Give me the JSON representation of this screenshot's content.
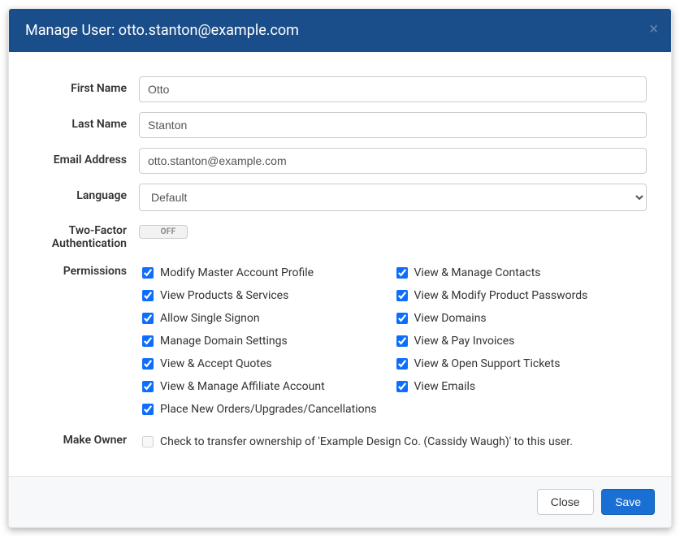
{
  "header": {
    "title": "Manage User: otto.stanton@example.com"
  },
  "labels": {
    "firstName": "First Name",
    "lastName": "Last Name",
    "email": "Email Address",
    "language": "Language",
    "twoFactor": "Two-Factor Authentication",
    "permissions": "Permissions",
    "makeOwner": "Make Owner"
  },
  "values": {
    "firstName": "Otto",
    "lastName": "Stanton",
    "email": "otto.stanton@example.com",
    "language": "Default",
    "twoFactorState": "OFF"
  },
  "permissions": {
    "col1": [
      "Modify Master Account Profile",
      "View Products & Services",
      "Allow Single Signon",
      "Manage Domain Settings",
      "View & Accept Quotes",
      "View & Manage Affiliate Account",
      "Place New Orders/Upgrades/Cancellations"
    ],
    "col2": [
      "View & Manage Contacts",
      "View & Modify Product Passwords",
      "View Domains",
      "View & Pay Invoices",
      "View & Open Support Tickets",
      "View Emails"
    ]
  },
  "makeOwner": {
    "text": "Check to transfer ownership of 'Example Design Co. (Cassidy Waugh)' to this user."
  },
  "footer": {
    "close": "Close",
    "save": "Save"
  }
}
